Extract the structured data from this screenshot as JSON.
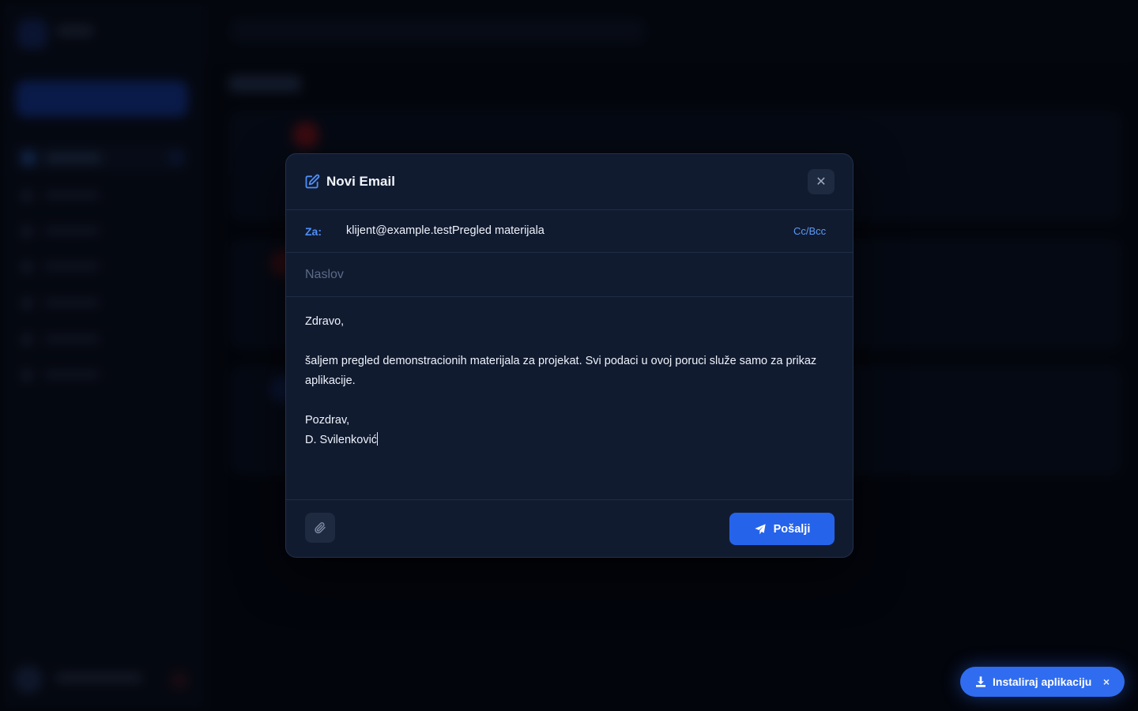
{
  "modal": {
    "title": "Novi Email",
    "close_symbol": "✕",
    "to_label": "Za:",
    "to_value": "klijent@example.testPregled materijala",
    "ccbcc_label": "Cc/Bcc",
    "subject_placeholder": "Naslov",
    "subject_value": "",
    "body_lines": [
      "Zdravo,",
      "",
      "šaljem pregled demonstracionih materijala za projekat. Svi podaci u ovoj poruci služe samo za prikaz aplikacije.",
      "",
      "Pozdrav,",
      "D. Svilenković"
    ],
    "send_label": "Pošalji",
    "icons": {
      "title": "edit-icon",
      "close": "close-icon",
      "attach": "paperclip-icon",
      "send": "paper-plane-icon"
    }
  },
  "install_banner": {
    "label": "Instaliraj aplikaciju",
    "close_symbol": "×",
    "icon": "download-icon"
  },
  "colors": {
    "accent": "#2563eb",
    "modal_bg": "#111b30",
    "label_blue": "#4f8ff7"
  }
}
